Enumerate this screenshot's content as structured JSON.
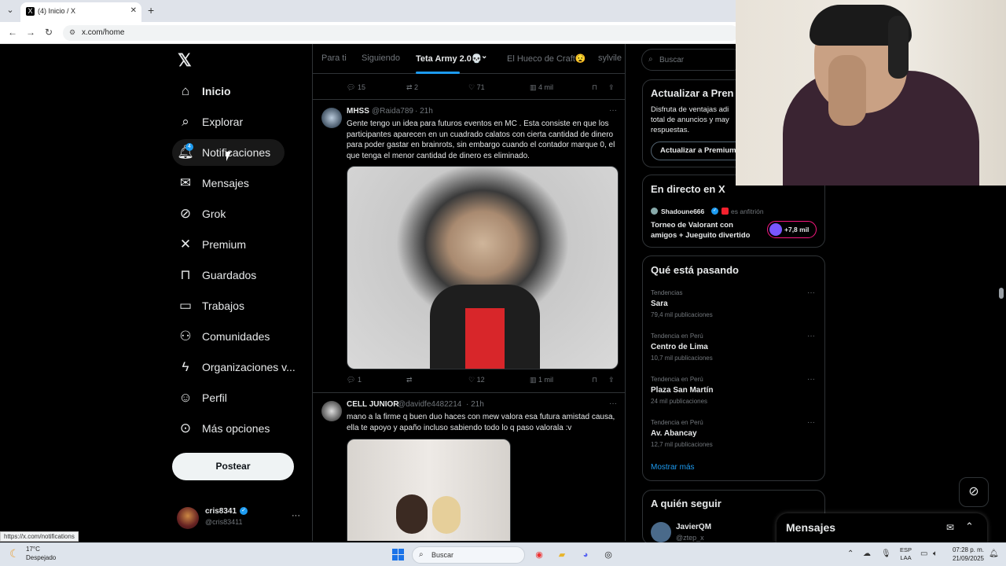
{
  "browser": {
    "tab_title": "(4) Inicio / X",
    "url": "x.com/home",
    "status_url": "https://x.com/notifications"
  },
  "nav": {
    "logo": "𝕏",
    "items": [
      {
        "label": "Inicio",
        "icon": "home-icon"
      },
      {
        "label": "Explorar",
        "icon": "search-icon"
      },
      {
        "label": "Notificaciones",
        "icon": "bell-icon"
      },
      {
        "label": "Mensajes",
        "icon": "mail-icon"
      },
      {
        "label": "Grok",
        "icon": "grok-icon"
      },
      {
        "label": "Premium",
        "icon": "x-premium-icon"
      },
      {
        "label": "Guardados",
        "icon": "bookmark-icon"
      },
      {
        "label": "Trabajos",
        "icon": "briefcase-icon"
      },
      {
        "label": "Comunidades",
        "icon": "people-icon"
      },
      {
        "label": "Organizaciones v...",
        "icon": "lightning-icon"
      },
      {
        "label": "Perfil",
        "icon": "person-icon"
      },
      {
        "label": "Más opciones",
        "icon": "more-circle-icon"
      }
    ],
    "notif_badge": "4",
    "post_button": "Postear",
    "account": {
      "name": "cris8341",
      "handle": "@cris83411"
    }
  },
  "feed_tabs": [
    "Para ti",
    "Siguiendo",
    "Teta Army 2.0💀",
    "El Hueco de Craft😧",
    "sylvile"
  ],
  "top_actions": {
    "replies": "15",
    "reposts": "2",
    "likes": "71",
    "views": "4 mil"
  },
  "posts": [
    {
      "name": "MHSS",
      "handle": "@Raida789",
      "time": "· 21h",
      "text": "Gente tengo un idea para futuros eventos en MC . Esta consiste en que los participantes aparecen en un cuadrado calatos con cierta cantidad de dinero para poder gastar en brainrots, sin embargo cuando el contador marque 0, el que tenga el menor cantidad de dinero es eliminado.",
      "actions": {
        "replies": "1",
        "reposts": "",
        "likes": "12",
        "views": "1 mil"
      }
    },
    {
      "name": "CELL JUNIOR",
      "handle": "@davidfe4482214",
      "time": "· 21h",
      "text": "mano a la firme q buen duo haces con mew valora esa futura amistad causa, ella te apoyo y apaño incluso sabiendo todo lo q paso valorala :v"
    }
  ],
  "right": {
    "search_placeholder": "Buscar",
    "premium": {
      "title": "Actualizar a Pren",
      "desc": "Disfruta de ventajas adi total de anuncios y may respuestas.",
      "button": "Actualizar a Premium"
    },
    "live": {
      "title": "En directo en X",
      "host": "Shadoune666",
      "host_suffix": "es anfitrión",
      "stream_title": "Torneo de Valorant con amigos + Jueguito divertido",
      "listeners": "+7,8 mil"
    },
    "trends_title": "Qué está pasando",
    "trends": [
      {
        "context": "Tendencias",
        "name": "Sara",
        "count": "79,4 mil publicaciones"
      },
      {
        "context": "Tendencia en Perú",
        "name": "Centro de Lima",
        "count": "10,7 mil publicaciones"
      },
      {
        "context": "Tendencia en Perú",
        "name": "Plaza San Martín",
        "count": "24 mil publicaciones"
      },
      {
        "context": "Tendencia en Perú",
        "name": "Av. Abancay",
        "count": "12,7 mil publicaciones"
      }
    ],
    "show_more": "Mostrar más",
    "who_to_follow": "A quién seguir",
    "follow_name": "JavierQM",
    "follow_handle": "@ztep_x",
    "messages": "Mensajes"
  },
  "taskbar": {
    "temp": "17°C",
    "condition": "Despejado",
    "search": "Buscar",
    "lang_top": "ESP",
    "lang_bottom": "LAA",
    "time": "07:28 p. m.",
    "date": "21/09/2025"
  },
  "colors": {
    "accent": "#1d9bf0",
    "background": "#000000",
    "text": "#e7e9ea",
    "muted": "#71767b"
  }
}
